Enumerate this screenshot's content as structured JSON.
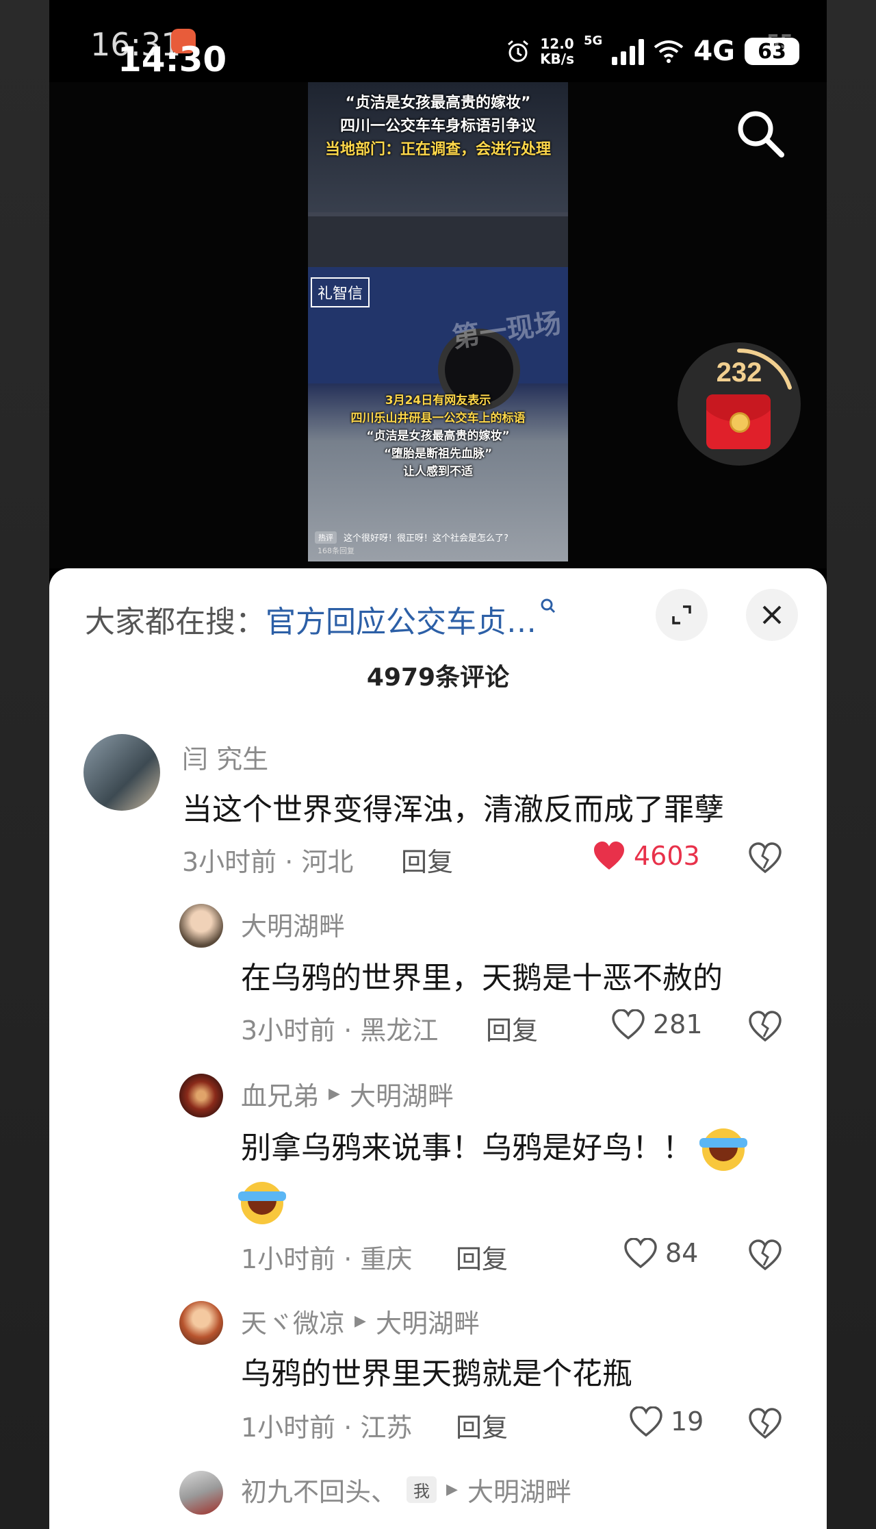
{
  "status_bar": {
    "time_ghost": "16:31",
    "time": "14:30",
    "net_speed_value": "12.0",
    "net_speed_unit": "KB/s",
    "signal_tag": "5G",
    "network": "4G",
    "battery_ghost": "55",
    "battery": "63"
  },
  "video": {
    "headline_lines": [
      "“贞洁是女孩最高贵的嫁妆”",
      "四川一公交车车身标语引争议",
      "当地部门：正在调查，会进行处理"
    ],
    "bus_sign": "礼智信",
    "watermark": "第一现场",
    "caption_lines": [
      "3月24日有网友表示",
      "四川乐山井研县一公交车上的标语",
      "“贞洁是女孩最高贵的嫁妆”",
      "“堕胎是断祖先血脉”",
      "让人感到不适"
    ],
    "hot_tag": "热评",
    "hot_comment": "这个很好呀！很正呀！这个社会是怎么了?",
    "reply_count": "168条回复"
  },
  "redpack": {
    "count": "232"
  },
  "comments_panel": {
    "suggest_prefix": "大家都在搜：",
    "suggest_query": "官方回应公交车贞…",
    "count_title": "4979条评论",
    "reply_label": "回复",
    "comments": [
      {
        "user": "闫 究生",
        "text": "当这个世界变得浑浊，清澈反而成了罪孽",
        "meta": "3小时前 · 河北",
        "likes": "4603",
        "liked": true
      },
      {
        "user": "大明湖畔",
        "text": "在乌鸦的世界里，天鹅是十恶不赦的",
        "meta": "3小时前 · 黑龙江",
        "likes": "281"
      },
      {
        "user": "血兄弟",
        "reply_to": "大明湖畔",
        "text": "别拿乌鸦来说事！乌鸦是好鸟！！",
        "meta": "1小时前 · 重庆",
        "likes": "84"
      },
      {
        "user": "天ヾ微凉",
        "reply_to": "大明湖畔",
        "text": "乌鸦的世界里天鹅就是个花瓶",
        "meta": "1小时前 · 江苏",
        "likes": "19"
      },
      {
        "user": "初九不回头、",
        "me_tag": "我",
        "reply_to": "大明湖畔"
      }
    ]
  },
  "colors": {
    "accent_link": "#2c5fa6",
    "like_red": "#e8314a",
    "redpack_red": "#e0202a"
  }
}
